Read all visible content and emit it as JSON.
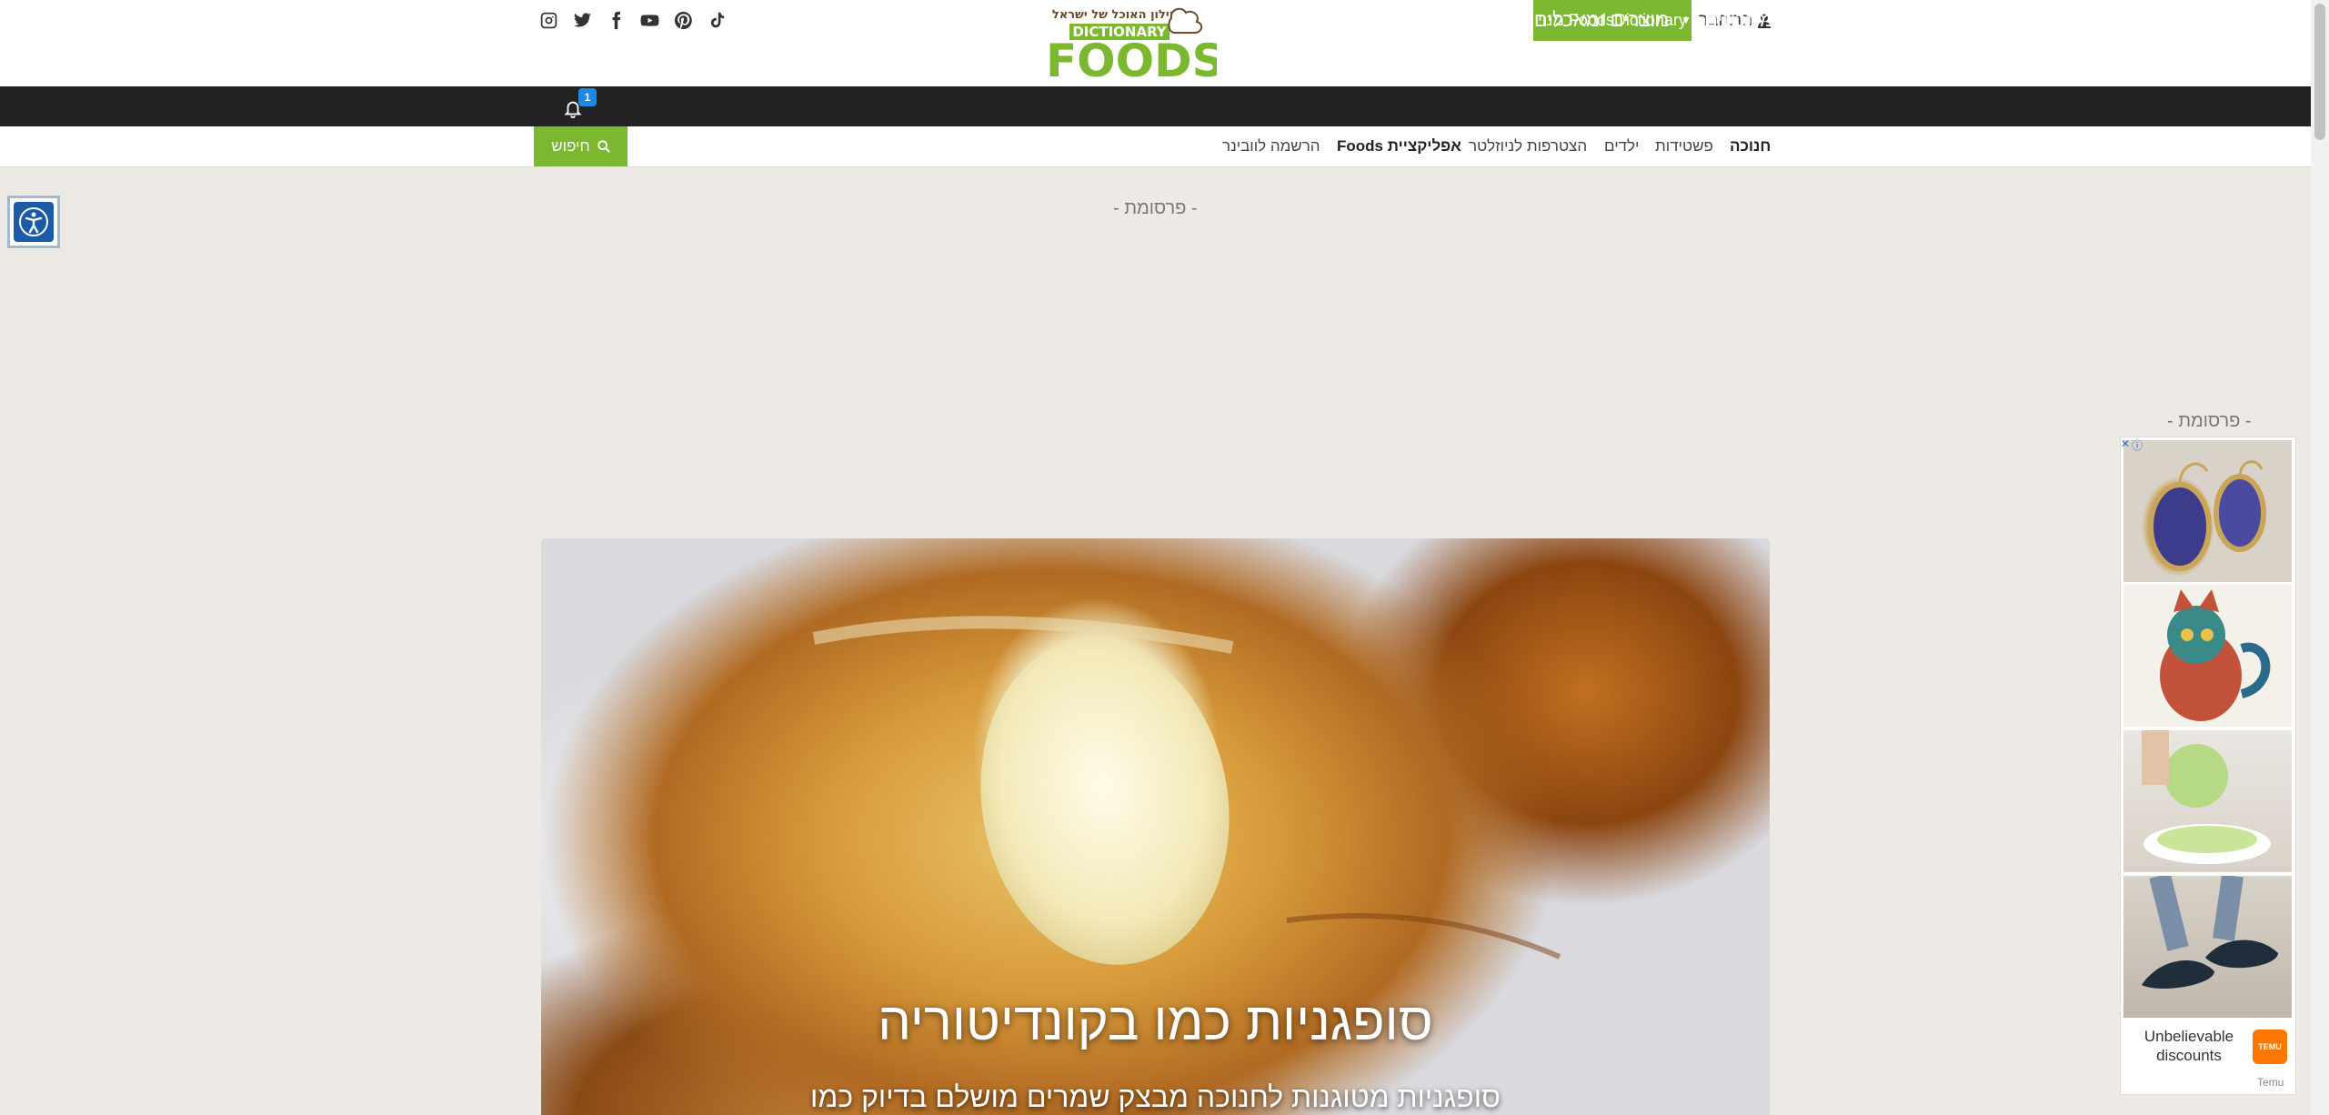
{
  "header": {
    "logo": {
      "tagline": "מילון האוכל של ישראל",
      "word1": "DICTIONARY",
      "word2": "FOODS"
    },
    "login_label": "התחבר",
    "subscribe_label": "מנוי FoodsDictionary",
    "social": [
      "tiktok-icon",
      "pinterest-icon",
      "youtube-icon",
      "facebook-icon",
      "twitter-icon",
      "instagram-icon"
    ]
  },
  "nav": {
    "items": [
      {
        "label": "מתכונים"
      },
      {
        "label": "מוצרים ומאכלים"
      },
      {
        "label": "מחשבון קלוריות"
      },
      {
        "label": "כתבות"
      }
    ],
    "notification_count": "1"
  },
  "subnav": {
    "items": [
      "חנוכה",
      "פשטידות",
      "ילדים",
      "הצטרפות לניוזלטר",
      "אפליקציית Foods",
      "הרשמה לוובינר"
    ],
    "search_label": "חיפוש"
  },
  "ads": {
    "label_top": "- פרסומת -",
    "label_side": "- פרסומת -",
    "side_text": "Unbelievable discounts",
    "side_brand": "Temu",
    "side_logo_text": "TEMU"
  },
  "hero": {
    "title": "סופגניות כמו בקונדיטוריה",
    "subtitle": "סופגניות מטוגנות לחנוכה מבצק שמרים מושלם בדיוק כמו"
  },
  "colors": {
    "green": "#7cb82f",
    "dark_nav": "#222222",
    "badge": "#1e88e5",
    "background": "#edeae6"
  }
}
